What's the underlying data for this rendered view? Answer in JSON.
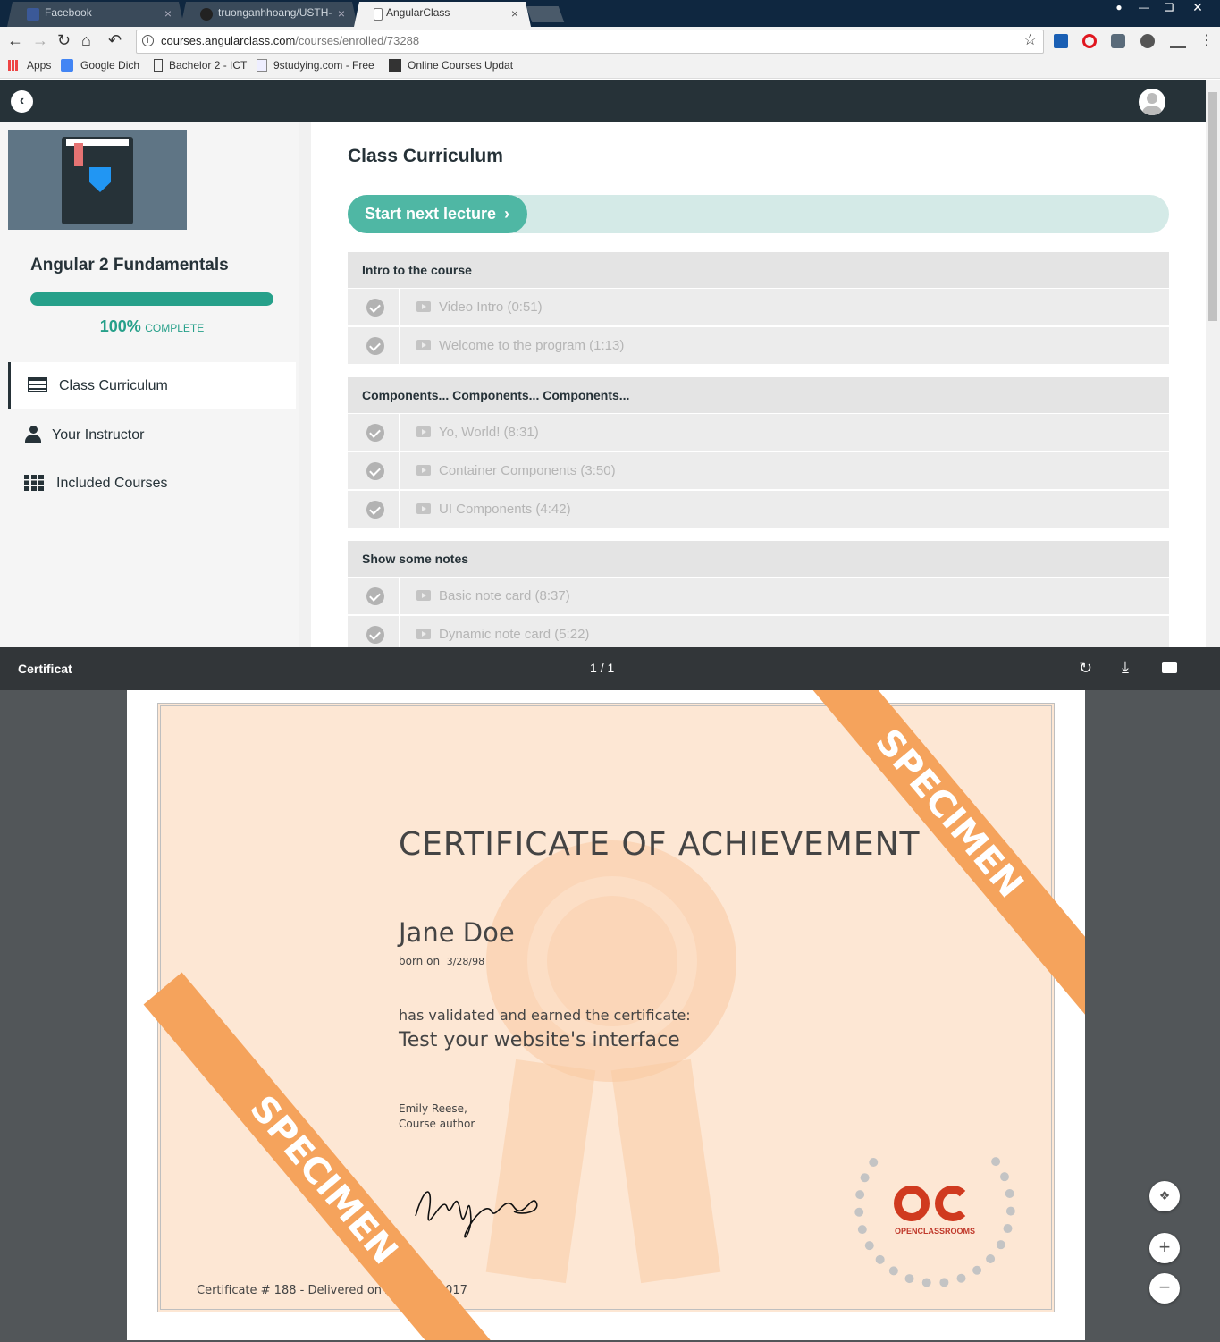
{
  "browser": {
    "tabs": [
      {
        "label": "Facebook"
      },
      {
        "label": "truonganhhoang/USTH-"
      },
      {
        "label": "AngularClass"
      }
    ],
    "close_glyph": "×",
    "url_host": "courses.angularclass.com",
    "url_path": "/courses/enrolled/73288",
    "bookmarks": [
      {
        "label": "Apps"
      },
      {
        "label": "Google Dich"
      },
      {
        "label": "Bachelor 2 - ICT"
      },
      {
        "label": "9studying.com - Free"
      },
      {
        "label": "Online Courses Updat"
      }
    ]
  },
  "sidebar": {
    "course_title": "Angular 2 Fundamentals",
    "progress": 1.0,
    "progress_pct": "100%",
    "progress_label": "COMPLETE",
    "nav": [
      {
        "label": "Class Curriculum",
        "icon": "list-icon"
      },
      {
        "label": "Your Instructor",
        "icon": "user-icon"
      },
      {
        "label": "Included Courses",
        "icon": "grid-icon"
      }
    ]
  },
  "main": {
    "title": "Class Curriculum",
    "next_button": "Start next lecture",
    "next_arrow": "›",
    "sections": [
      {
        "title": "Intro to the course",
        "lectures": [
          "Video Intro (0:51)",
          "Welcome to the program (1:13)"
        ]
      },
      {
        "title": "Components... Components... Components...",
        "lectures": [
          "Yo, World! (8:31)",
          "Container Components (3:50)",
          "UI Components (4:42)"
        ]
      },
      {
        "title": "Show some notes",
        "lectures": [
          "Basic note card (8:37)",
          "Dynamic note card (5:22)"
        ]
      }
    ]
  },
  "pdf": {
    "title": "Certificat",
    "page_current": "1",
    "page_sep": "/",
    "page_total": "1"
  },
  "certificate": {
    "heading": "CERTIFICATE OF ACHIEVEMENT",
    "name": "Jane Doe",
    "born_label": "born on",
    "born_date": "3/28/98",
    "validated": "has validated and earned the certificate:",
    "course": "Test your website's interface",
    "author": "Emily Reese,",
    "author_role": "Course author",
    "footer": "Certificate # 188 - Delivered on April 27, 2017",
    "ribbon": "SPECIMEN",
    "logo_text": "OPENCLASSROOMS"
  },
  "colors": {
    "accent": "#26a08a",
    "header": "#263238",
    "ribbon": "#f5a35c"
  }
}
